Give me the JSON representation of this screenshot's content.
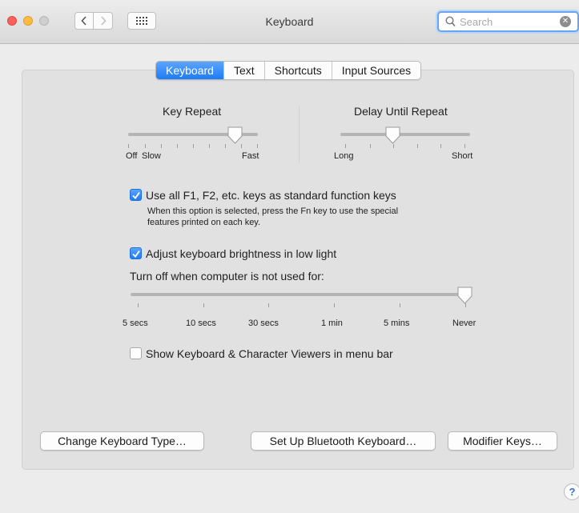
{
  "window": {
    "title": "Keyboard"
  },
  "search": {
    "placeholder": "Search"
  },
  "tabs": [
    {
      "label": "Keyboard",
      "active": true
    },
    {
      "label": "Text",
      "active": false
    },
    {
      "label": "Shortcuts",
      "active": false
    },
    {
      "label": "Input Sources",
      "active": false
    }
  ],
  "key_repeat": {
    "title": "Key Repeat",
    "min_label": "Off",
    "min_label2": "Slow",
    "max_label": "Fast",
    "value_fraction": 0.83
  },
  "delay_until_repeat": {
    "title": "Delay Until Repeat",
    "min_label": "Long",
    "max_label": "Short",
    "value_fraction": 0.4
  },
  "function_keys": {
    "checked": true,
    "label": "Use all F1, F2, etc. keys as standard function keys",
    "help_line1": "When this option is selected, press the Fn key to use the special",
    "help_line2": "features printed on each key."
  },
  "brightness": {
    "checked": true,
    "label": "Adjust keyboard brightness in low light",
    "turn_off_label": "Turn off when computer is not used for:",
    "ticks": [
      "5 secs",
      "10 secs",
      "30 secs",
      "1 min",
      "5 mins",
      "Never"
    ],
    "selected": "Never"
  },
  "viewers": {
    "checked": false,
    "label": "Show Keyboard & Character Viewers in menu bar"
  },
  "buttons": {
    "change_type": "Change Keyboard Type…",
    "bluetooth": "Set Up Bluetooth Keyboard…",
    "modifier": "Modifier Keys…",
    "help": "?"
  },
  "colors": {
    "accent": "#1f7cf4",
    "close": "#fc605b",
    "minimize": "#fdbc40"
  }
}
